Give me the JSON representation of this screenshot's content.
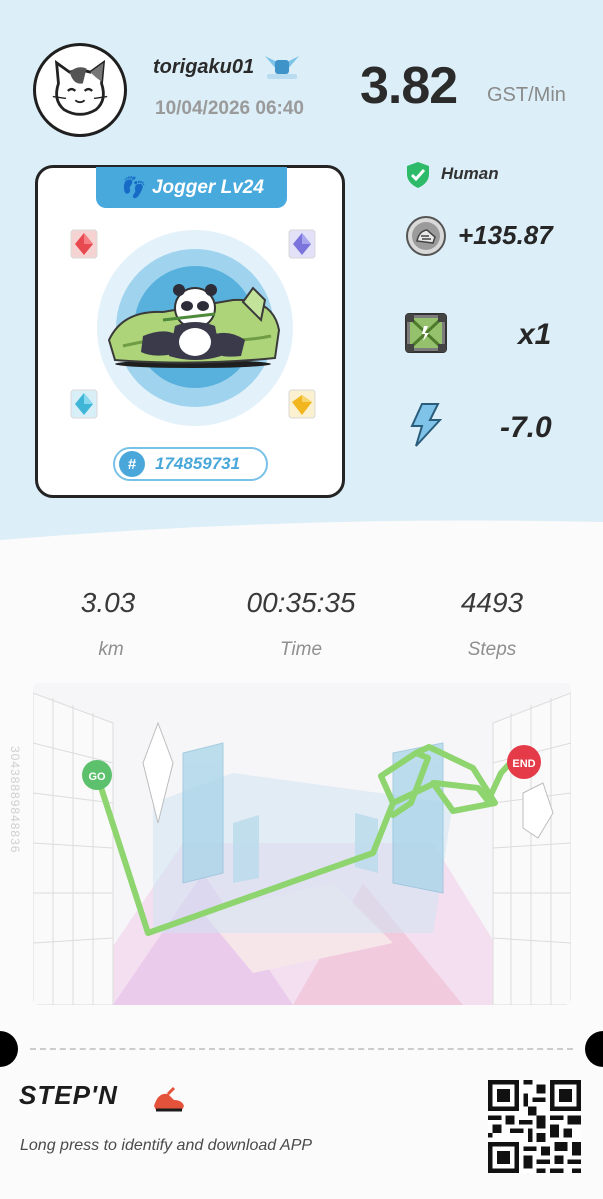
{
  "profile": {
    "username": "torigaku01",
    "datetime": "10/04/2026 06:40",
    "avatar": "cat-avatar",
    "badge": "winged-badge-icon"
  },
  "earning_rate": {
    "value": "3.82",
    "unit": "GST/Min"
  },
  "sneaker_card": {
    "level_label": "Jogger Lv24",
    "id_label": "174859731",
    "gems": [
      "red-gem-icon",
      "purple-gem-icon",
      "blue-gem-icon",
      "yellow-gem-icon"
    ]
  },
  "stats_side": {
    "human_label": "Human",
    "earned": "+135.87",
    "mystery_box": "x1",
    "energy": "-7.0"
  },
  "workout": {
    "distance": {
      "value": "3.03",
      "label": "km"
    },
    "time": {
      "value": "00:35:35",
      "label": "Time"
    },
    "steps": {
      "value": "4493",
      "label": "Steps"
    }
  },
  "map": {
    "start_label": "GO",
    "end_label": "END",
    "serial": "30438889848836",
    "route_color": "#8ed46f"
  },
  "footer": {
    "logo": "STEP'N",
    "tagline": "Long press to identify and download APP"
  },
  "colors": {
    "panel_bg": "#dceef7",
    "accent_blue": "#47a9dc",
    "go_green": "#5cc06d",
    "end_red": "#e53b49"
  }
}
